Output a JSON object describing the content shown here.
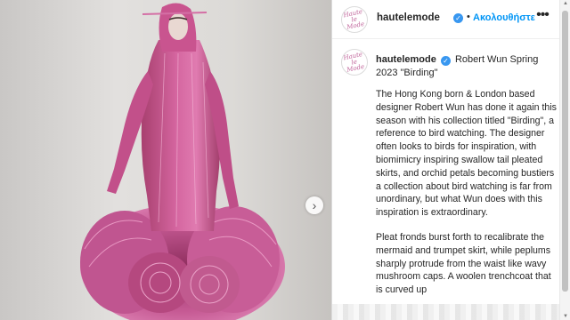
{
  "post": {
    "image_alt": "",
    "next_label": "›"
  },
  "header": {
    "username": "hautelemode",
    "avatar_text": "Haute le Mode",
    "verified": "✓",
    "separator": "•",
    "follow": "Ακολουθήστε",
    "more": "•••"
  },
  "caption": {
    "username": "hautelemode",
    "verified": "✓",
    "title": "Robert Wun Spring 2023 \"Birding\"",
    "paragraphs": [
      "The Hong Kong born & London based designer Robert Wun has done it again this season with his collection titled \"Birding\", a reference to bird watching. The designer often looks to birds for inspiration, with biomimicry inspiring swallow tail pleated skirts, and orchid petals becoming bustiers a collection about bird watching is far from unordinary, but what Wun does with this inspiration is extraordinary.",
      "Pleat fronds burst forth to recalibrate the mermaid and trumpet skirt, while peplums sharply protrude from the waist like wavy mushroom caps. A woolen trenchcoat that is curved up"
    ]
  },
  "scrollbar": {
    "up": "▲",
    "down": "▼"
  },
  "colors": {
    "accent": "#0095f6",
    "verified": "#3897f0",
    "dress": "#c8548f",
    "text": "#262626"
  }
}
